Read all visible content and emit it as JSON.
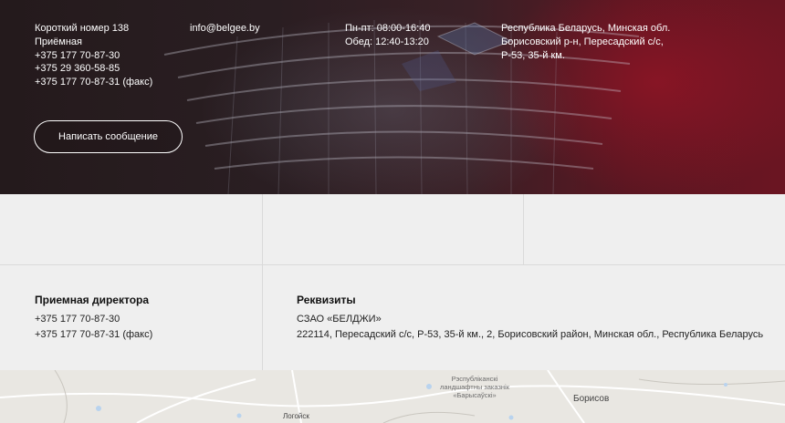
{
  "hero": {
    "col1": [
      "Короткий номер 138",
      "Приёмная",
      "+375 177 70-87-30",
      "+375 29 360-58-85",
      "+375 177 70-87-31 (факс)"
    ],
    "col2": [
      "info@belgee.by"
    ],
    "col3": [
      "Пн-пт: 08:00-16:40",
      "Обед: 12:40-13:20"
    ],
    "col4": [
      "Республика Беларусь, Минская обл.",
      "Борисовский р-н, Пересадский с/с,",
      "Р-53, 35-й км."
    ],
    "button_label": "Написать сообщение"
  },
  "director": {
    "title": "Приемная директора",
    "lines": [
      "+375 177 70-87-30",
      "+375 177 70-87-31 (факс)"
    ]
  },
  "requisites": {
    "title": "Реквизиты",
    "lines": [
      "СЗАО «БЕЛДЖИ»",
      "222114, Пересадский с/с, Р-53, 35-й км., 2, Борисовский район, Минская обл., Республика Беларусь"
    ]
  },
  "map": {
    "reserve_label": [
      "Рэспубліканскі",
      "ландшафтны заказнік",
      "«Барысаўскі»"
    ],
    "city_borisov": "Борисов",
    "city_logoisk": "Логойск"
  },
  "colors": {
    "hero_dark": "#241a1c",
    "hero_red": "#6b1522",
    "grid_bg": "#efefef",
    "map_bg": "#e9e7e2"
  }
}
